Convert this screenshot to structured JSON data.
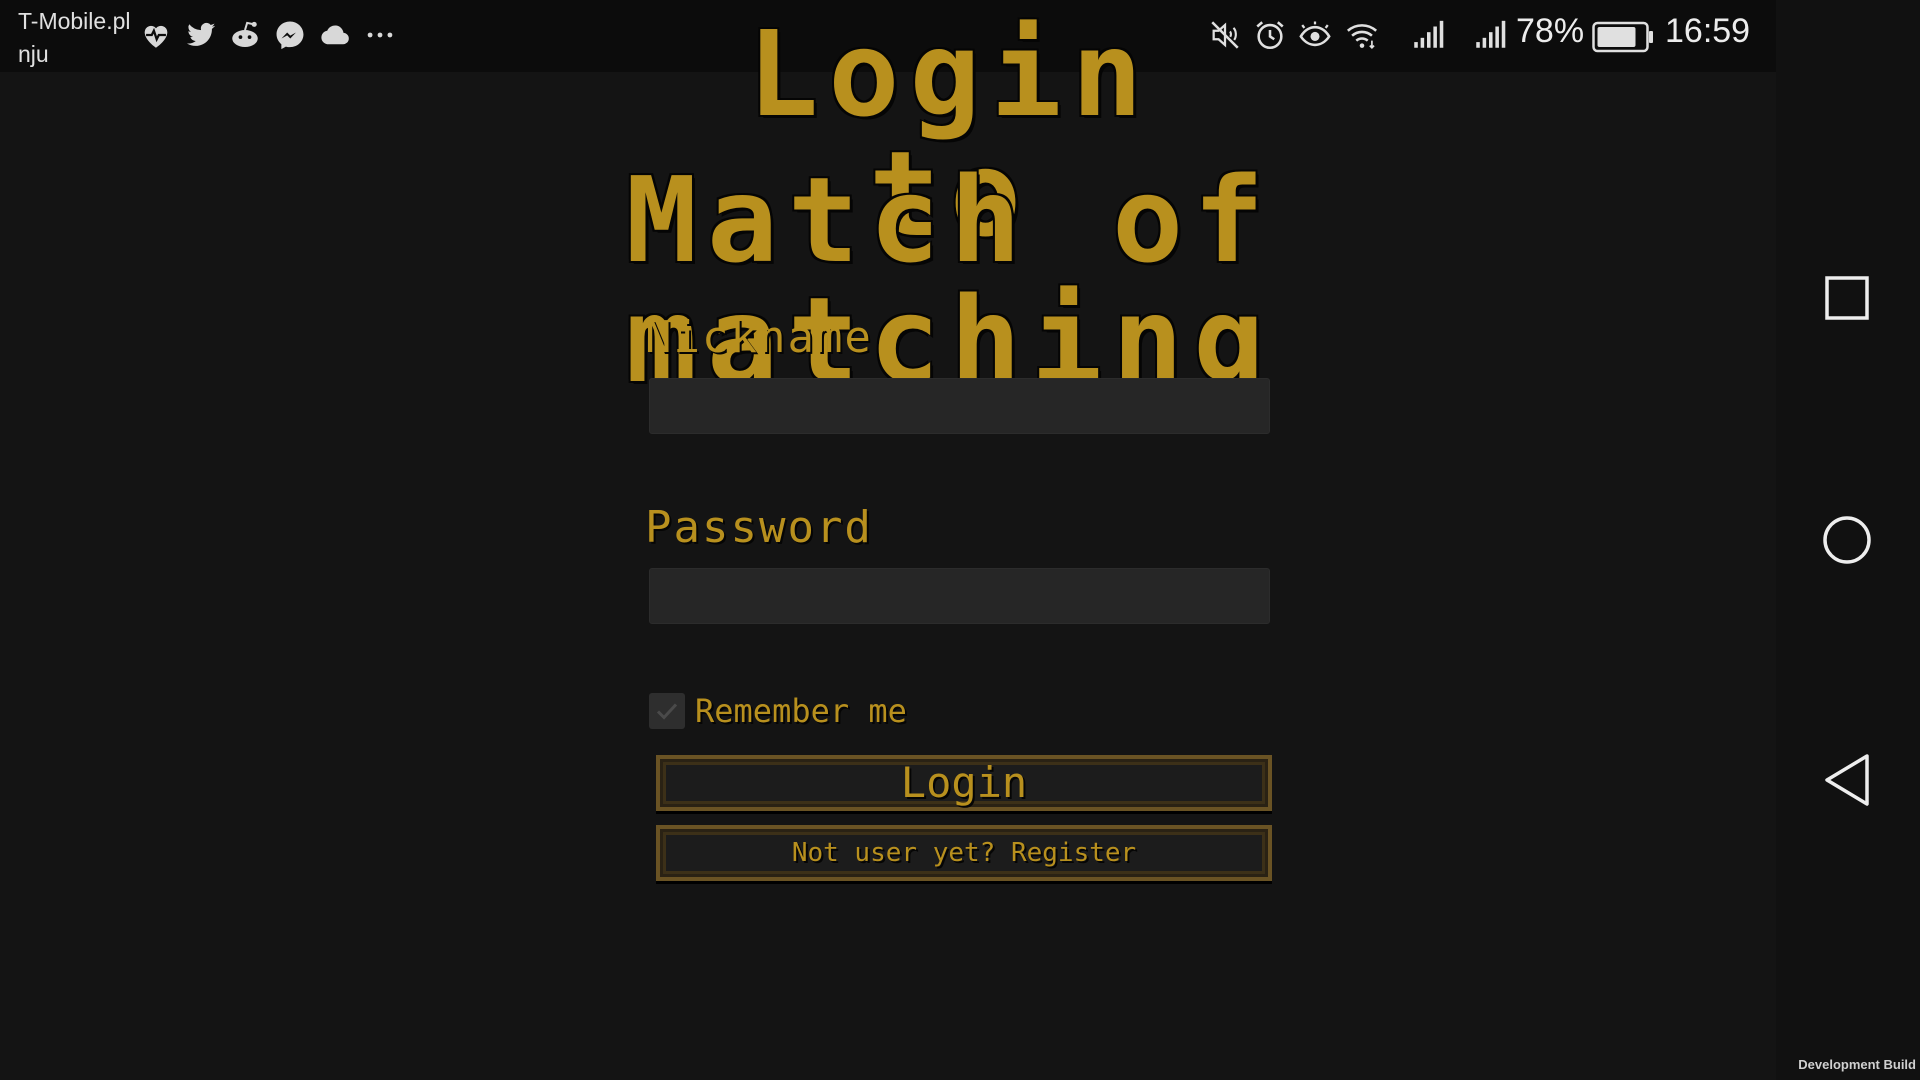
{
  "status_bar": {
    "carrier_line_1": "T-Mobile.pl",
    "carrier_line_2": "nju",
    "notification_icons": [
      "health-heart-icon",
      "twitter-icon",
      "reddit-icon",
      "messenger-icon",
      "cloud-icon",
      "more-dots-icon"
    ],
    "system_icons": [
      "mute-icon",
      "alarm-icon",
      "eye-comfort-icon",
      "wifi-icon",
      "signal-1-icon",
      "signal-2-icon",
      "battery-icon"
    ],
    "battery": "78%",
    "time": "16:59"
  },
  "game": {
    "title_line_1": "Login to",
    "title_line_2": "Match of matching",
    "accent_color": "#b8901e"
  },
  "form": {
    "nickname_label": "Nickname",
    "nickname_value": "",
    "password_label": "Password",
    "password_value": "",
    "remember_label": "Remember me",
    "remember_checked": true,
    "login_button": "Login",
    "register_button": "Not user yet? Register"
  },
  "nav_bar": {
    "buttons": [
      "recents-square-icon",
      "home-circle-icon",
      "back-triangle-icon"
    ],
    "dev_build_label": "Development Build"
  }
}
